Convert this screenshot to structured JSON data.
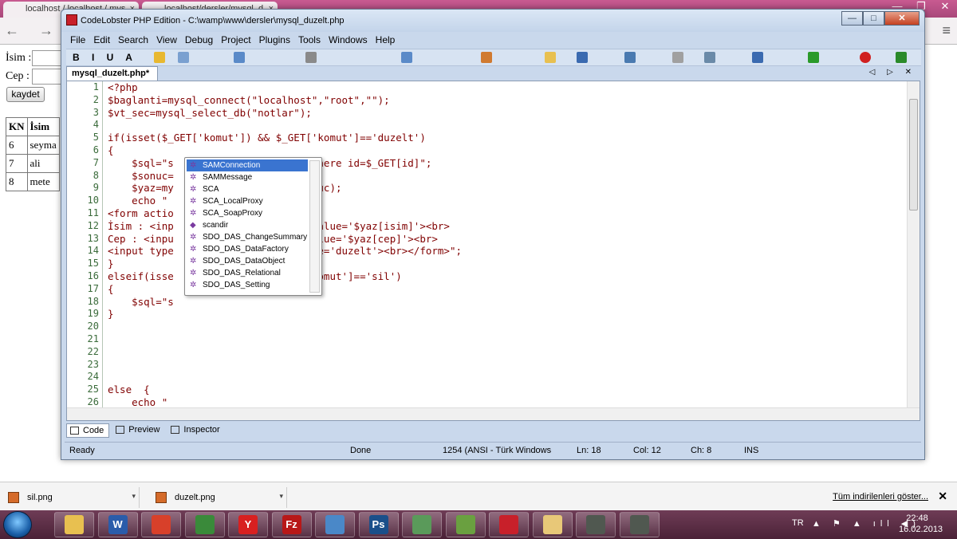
{
  "browser": {
    "tabs": [
      {
        "label": "localhost / localhost / mys"
      },
      {
        "label": "localhost/dersler/mysql_d"
      }
    ],
    "close_glyph": "×",
    "controls": [
      "—",
      "❐",
      "✕"
    ],
    "nav_glyphs": "← → C",
    "menu_glyph": "≡"
  },
  "webpage": {
    "isim_label": "İsim :",
    "cep_label": "Cep :",
    "kaydet_label": "kaydet",
    "table": {
      "headers": [
        "KN",
        "İsim"
      ],
      "rows": [
        [
          "6",
          "seyma"
        ],
        [
          "7",
          "ali"
        ],
        [
          "8",
          "mete"
        ]
      ]
    }
  },
  "ide": {
    "title": "CodeLobster PHP Edition - C:\\wamp\\www\\dersler\\mysql_duzelt.php",
    "window_controls": {
      "minimize": "—",
      "maximize": "□",
      "close": "✕"
    },
    "menu": [
      "File",
      "Edit",
      "Search",
      "View",
      "Debug",
      "Project",
      "Plugins",
      "Tools",
      "Windows",
      "Help"
    ],
    "format_toolbar": "B I U A",
    "doc_tab": "mysql_duzelt.php*",
    "doc_tab_controls": "◁ ▷ ✕",
    "line_numbers": [
      "1",
      "2",
      "3",
      "4",
      "5",
      "6",
      "7",
      "8",
      "9",
      "10",
      "11",
      "12",
      "13",
      "14",
      "15",
      "16",
      "17",
      "18",
      "19",
      "20",
      "21",
      "22",
      "23",
      "24",
      "25",
      "26"
    ],
    "code_lines": [
      "<?php",
      "$baglanti=mysql_connect(\"localhost\",\"root\",\"\");",
      "$vt_sec=mysql_select_db(\"notlar\");",
      "",
      "if(isset($_GET['komut']) && $_GET['komut']=='duzelt')",
      "{",
      "    $sql=\"s                       where id=$_GET[id]\";",
      "    $sonuc=",
      "    $yaz=my                        uc);",
      "    echo \"",
      "<form actio",
      "İsim : <inp                'isim' value='$yaz[isim]'><br>",
      "Cep : <inpu                'cep' value='$yaz[cep]'><br>",
      "<input type                lt' value='duzelt'><br></form>\";",
      "}",
      "elseif(isse                $_GET['komut']=='sil')",
      "{",
      "    $sql=\"s",
      "}",
      "",
      "",
      "",
      "",
      "",
      "else  {",
      "    echo \""
    ],
    "autocomplete": [
      "SAMConnection",
      "SAMMessage",
      "SCA",
      "SCA_LocalProxy",
      "SCA_SoapProxy",
      "scandir",
      "SDO_DAS_ChangeSummary",
      "SDO_DAS_DataFactory",
      "SDO_DAS_DataObject",
      "SDO_DAS_Relational",
      "SDO_DAS_Setting"
    ],
    "autocomplete_selected": 0,
    "view_tabs": [
      "Code",
      "Preview",
      "Inspector"
    ],
    "status": {
      "ready": "Ready",
      "done": "Done",
      "encoding": "1254 (ANSI - Türk Windows",
      "line": "Ln: 18",
      "col": "Col: 12",
      "ch": "Ch: 8",
      "mode": "INS"
    }
  },
  "downloads": {
    "items": [
      {
        "label": "sil.png"
      },
      {
        "label": "duzelt.png"
      }
    ],
    "show_all": "Tüm indirilenleri göster...",
    "close": "✕"
  },
  "taskbar": {
    "apps": [
      {
        "name": "explorer",
        "glyph": "",
        "color": "#e8c050"
      },
      {
        "name": "word",
        "glyph": "W",
        "color": "#2a5caa"
      },
      {
        "name": "chrome",
        "glyph": "",
        "color": "#d8402a"
      },
      {
        "name": "image-viewer",
        "glyph": "",
        "color": "#3a8a3a"
      },
      {
        "name": "yandex",
        "glyph": "Y",
        "color": "#d82020"
      },
      {
        "name": "filezilla",
        "glyph": "Fz",
        "color": "#b81818"
      },
      {
        "name": "speaker",
        "glyph": "",
        "color": "#4a88c8"
      },
      {
        "name": "photoshop",
        "glyph": "Ps",
        "color": "#1a4f8a"
      },
      {
        "name": "users",
        "glyph": "",
        "color": "#5a9a5a"
      },
      {
        "name": "chart",
        "glyph": "",
        "color": "#6aa040"
      },
      {
        "name": "codelobster",
        "glyph": "",
        "color": "#c8202a"
      },
      {
        "name": "folder",
        "glyph": "",
        "color": "#e8c878"
      },
      {
        "name": "tool-a",
        "glyph": "",
        "color": "#505850"
      },
      {
        "name": "tool-b",
        "glyph": "",
        "color": "#505850"
      }
    ],
    "lang": "TR",
    "tray": "▲ ⚑ ▲ ıll ◀)",
    "time": "22:48",
    "date": "16.02.2013"
  }
}
